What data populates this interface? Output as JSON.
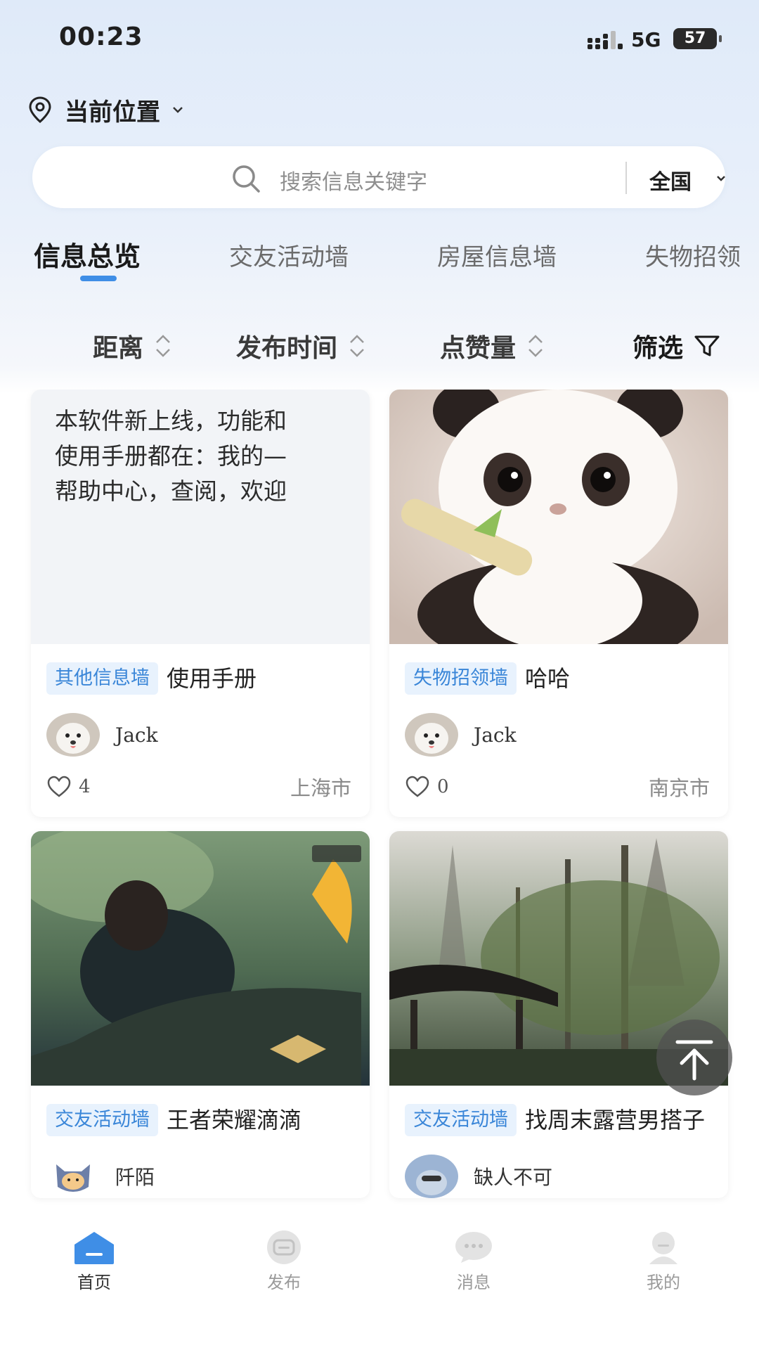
{
  "status_bar": {
    "time": "00:23",
    "network": "5G",
    "battery": "57"
  },
  "location": {
    "label": "当前位置"
  },
  "search": {
    "placeholder": "搜索信息关键字",
    "region": "全国"
  },
  "tabs": [
    {
      "label": "信息总览",
      "active": true
    },
    {
      "label": "交友活动墙",
      "active": false
    },
    {
      "label": "房屋信息墙",
      "active": false
    },
    {
      "label": "失物招领",
      "active": false
    }
  ],
  "sort": [
    {
      "label": "距离"
    },
    {
      "label": "发布时间"
    },
    {
      "label": "点赞量"
    },
    {
      "label": "筛选"
    }
  ],
  "cards": [
    {
      "excerpt_lines": [
        "本软件新上线，功能和",
        "使用手册都在：我的—",
        "帮助中心，查阅，欢迎"
      ],
      "tag": "其他信息墙",
      "title": "使用手册",
      "author": "Jack",
      "likes": "4",
      "city": "上海市"
    },
    {
      "tag": "失物招领墙",
      "title": "哈哈",
      "author": "Jack",
      "likes": "0",
      "city": "南京市"
    },
    {
      "tag": "交友活动墙",
      "title": "王者荣耀滴滴",
      "author": "阡陌"
    },
    {
      "tag": "交友活动墙",
      "title": "找周末露营男搭子",
      "author": "缺人不可"
    }
  ],
  "bottom_nav": [
    {
      "label": "首页",
      "icon": "home-icon",
      "active": true
    },
    {
      "label": "发布",
      "icon": "publish-icon",
      "active": false
    },
    {
      "label": "消息",
      "icon": "message-icon",
      "active": false
    },
    {
      "label": "我的",
      "icon": "profile-icon",
      "active": false
    }
  ],
  "colors": {
    "accent": "#3f8ee6",
    "tag_bg": "#e8f2fd",
    "tag_text": "#3a86d8"
  }
}
